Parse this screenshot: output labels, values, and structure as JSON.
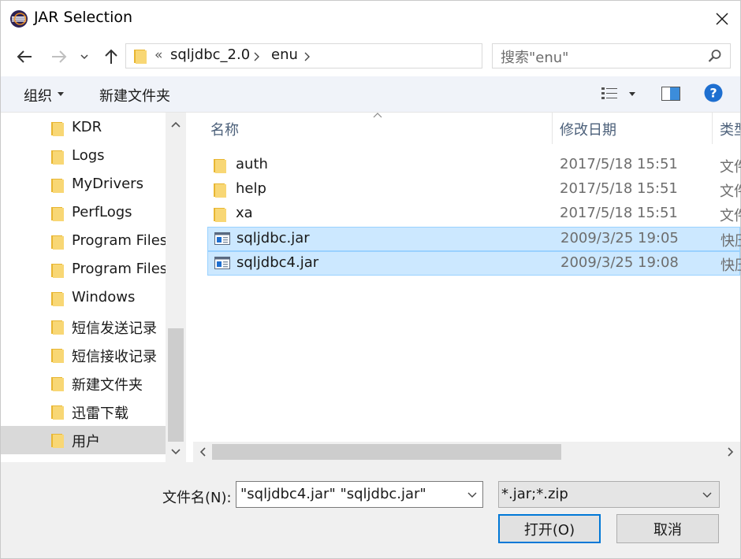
{
  "window": {
    "title": "JAR Selection"
  },
  "address": {
    "overflow": "«",
    "crumbs": [
      "sqljdbc_2.0",
      "enu"
    ],
    "search_placeholder": "搜索\"enu\""
  },
  "toolbar": {
    "organize": "组织",
    "new_folder": "新建文件夹"
  },
  "nav": {
    "items": [
      {
        "label": "KDR"
      },
      {
        "label": "Logs"
      },
      {
        "label": "MyDrivers"
      },
      {
        "label": "PerfLogs"
      },
      {
        "label": "Program Files"
      },
      {
        "label": "Program Files"
      },
      {
        "label": "Windows"
      },
      {
        "label": "短信发送记录"
      },
      {
        "label": "短信接收记录"
      },
      {
        "label": "新建文件夹"
      },
      {
        "label": "迅雷下载"
      },
      {
        "label": "用户",
        "selected": true
      }
    ]
  },
  "list": {
    "columns": {
      "name": "名称",
      "date": "修改日期",
      "type": "类型"
    },
    "rows": [
      {
        "name": "auth",
        "date": "2017/5/18 15:51",
        "type": "文件夹",
        "kind": "folder",
        "selected": false
      },
      {
        "name": "help",
        "date": "2017/5/18 15:51",
        "type": "文件夹",
        "kind": "folder",
        "selected": false
      },
      {
        "name": "xa",
        "date": "2017/5/18 15:51",
        "type": "文件夹",
        "kind": "folder",
        "selected": false
      },
      {
        "name": "sqljdbc.jar",
        "date": "2009/3/25 19:05",
        "type": "快压",
        "kind": "jar",
        "selected": true
      },
      {
        "name": "sqljdbc4.jar",
        "date": "2009/3/25 19:08",
        "type": "快压",
        "kind": "jar",
        "selected": true
      }
    ]
  },
  "bottom": {
    "filename_label": "文件名(N):",
    "filename_value": "\"sqljdbc4.jar\" \"sqljdbc.jar\"",
    "filter_value": "*.jar;*.zip",
    "open_label": "打开(O)",
    "cancel_label": "取消"
  },
  "colors": {
    "accent": "#0078d7",
    "selection": "#cce8ff",
    "folder": "#f8d775"
  },
  "icons": [
    "eclipse-icon",
    "close-icon",
    "back-arrow-icon",
    "forward-arrow-icon",
    "history-chevron-icon",
    "up-arrow-icon",
    "folder-icon",
    "chevron-down-icon",
    "refresh-icon",
    "search-icon",
    "view-options-icon",
    "preview-pane-icon",
    "help-icon",
    "jar-file-icon"
  ]
}
